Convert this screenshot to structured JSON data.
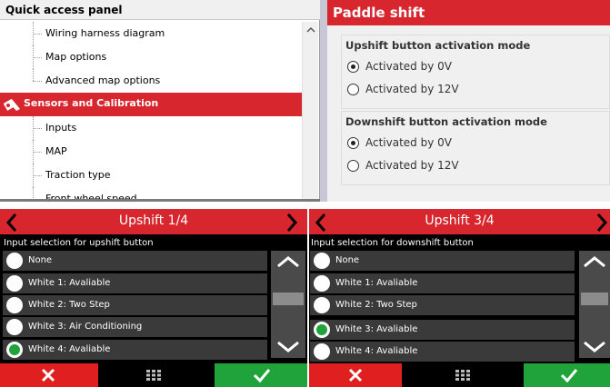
{
  "quick_access": {
    "title": "Quick access panel",
    "items": [
      {
        "label": "Wiring harness diagram"
      },
      {
        "label": "Map options"
      },
      {
        "label": "Advanced map options"
      },
      {
        "label": "Sensors and Calibration",
        "selected": true
      },
      {
        "label": "Inputs"
      },
      {
        "label": "MAP"
      },
      {
        "label": "Traction type"
      },
      {
        "label": "Front wheel speed"
      }
    ],
    "scroll_up_icon": "scroll-up-arrow"
  },
  "paddle_shift": {
    "title": "Paddle shift",
    "upshift_group": {
      "title": "Upshift button activation mode",
      "options": [
        "Activated by 0V",
        "Activated by 12V"
      ],
      "selected": "Activated by 0V"
    },
    "downshift_group": {
      "title": "Downshift button activation mode",
      "options": [
        "Activated by 0V",
        "Activated by 12V"
      ],
      "selected": "Activated by 0V"
    }
  },
  "device_left": {
    "title": "Upshift 1/4",
    "subtitle": "Input selection for upshift button",
    "options": [
      "None",
      "White 1: Avaliable",
      "White 2: Two Step",
      "White 3: Air Conditioning",
      "White 4: Avaliable"
    ],
    "selected_index": 4
  },
  "device_right": {
    "title": "Upshift 3/4",
    "subtitle": "Input selection for downshift button",
    "options": [
      "None",
      "White 1: Avaliable",
      "White 2: Two Step",
      "White 3: Avaliable",
      "White 4: Avaliable"
    ],
    "selected_index": 3
  },
  "colors": {
    "accent_red": "#d7262e",
    "cancel_red": "#e02020",
    "confirm_green": "#1fa33a",
    "panel_dark": "#3a3a3a"
  }
}
